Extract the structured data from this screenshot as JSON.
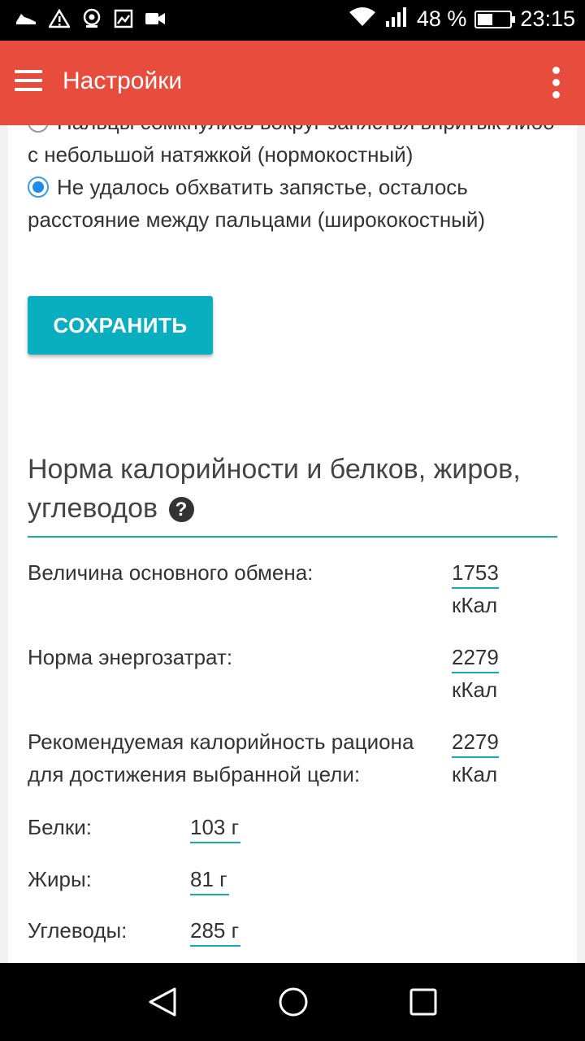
{
  "status_bar": {
    "battery_percent": "48 %",
    "battery_level": 0.48,
    "time": "23:15",
    "icons": [
      "shoe-icon",
      "warning-icon",
      "hotspot-icon",
      "image-icon",
      "video-icon",
      "wifi-icon",
      "signal-icon",
      "battery-icon"
    ]
  },
  "app_bar": {
    "title": "Настройки",
    "menu_icon": "menu-icon",
    "overflow_icon": "more-vert-icon",
    "color": "#e84c3d"
  },
  "wrist_test": {
    "options": [
      {
        "label": "Пальцы сомкнулись вокруг запястья впритык либо с небольшой натяжкой (нормокостный)",
        "selected": false
      },
      {
        "label": "Не удалось обхватить запястье, осталось расстояние между пальцами (ширококостный)",
        "selected": true
      }
    ],
    "save_label": "СОХРАНИТЬ",
    "accent": "#0aafbf"
  },
  "norms": {
    "title": "Норма калорийности и белков, жиров, углеводов",
    "help_icon": "help-circle-icon",
    "stats": [
      {
        "label": "Величина основного обмена:",
        "value": "1753",
        "unit": "кКал"
      },
      {
        "label": "Норма энергозатрат:",
        "value": "2279",
        "unit": "кКал"
      },
      {
        "label": "Рекомендуемая калорийность рациона для достижения выбранной цели:",
        "value": "2279",
        "unit": "кКал"
      }
    ],
    "macros": [
      {
        "label": "Белки:",
        "value": "103 г"
      },
      {
        "label": "Жиры:",
        "value": "81 г"
      },
      {
        "label": "Углеводы:",
        "value": "285 г"
      }
    ]
  },
  "nav_bar": {
    "buttons": [
      "back-icon",
      "home-icon",
      "recents-icon"
    ]
  }
}
